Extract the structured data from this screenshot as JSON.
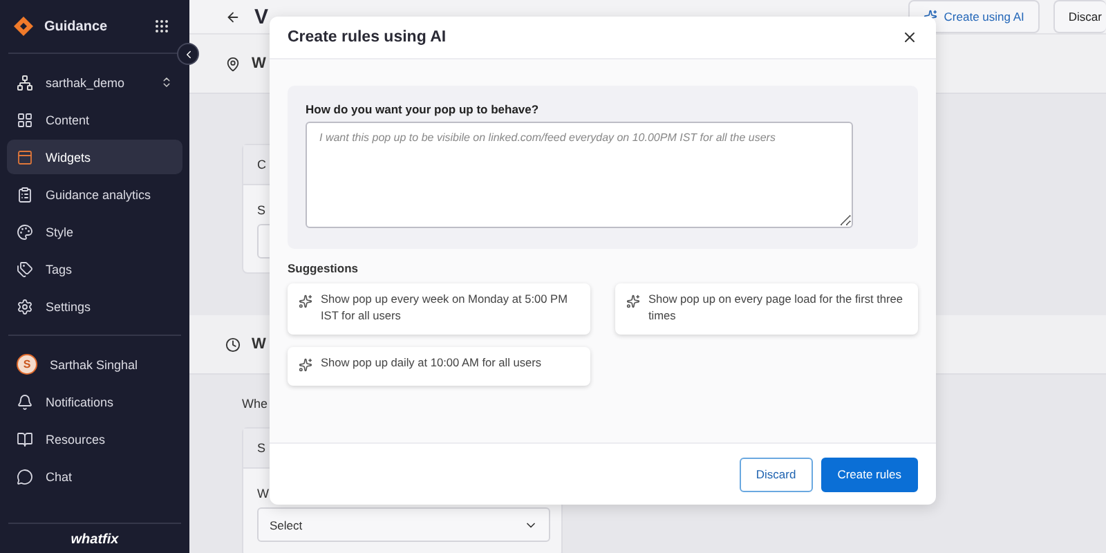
{
  "sidebar": {
    "brand": "Guidance",
    "workspace": "sarthak_demo",
    "nav": [
      {
        "label": "Content",
        "selected": false
      },
      {
        "label": "Widgets",
        "selected": true
      },
      {
        "label": "Guidance analytics",
        "selected": false
      },
      {
        "label": "Style",
        "selected": false
      },
      {
        "label": "Tags",
        "selected": false
      },
      {
        "label": "Settings",
        "selected": false
      }
    ],
    "user": {
      "initial": "S",
      "name": "Sarthak Singhal"
    },
    "links": [
      "Notifications",
      "Resources",
      "Chat"
    ],
    "footer_logo": "whatfix"
  },
  "header": {
    "title": "V",
    "buttons": [
      {
        "label": "Create using AI",
        "kind": "ai"
      },
      {
        "label": "Discar",
        "kind": "plain"
      }
    ]
  },
  "sections": [
    {
      "heading": "W",
      "card": {
        "title": "C",
        "label": "S"
      }
    },
    {
      "heading": "W",
      "question": "Whe",
      "card": {
        "title": "S",
        "label": "W",
        "value": "Select"
      }
    }
  ],
  "modal": {
    "title": "Create rules using AI",
    "prompt_label": "How do you want your pop up to behave?",
    "placeholder": "I want this pop up to be visibile on linked.com/feed everyday on 10.00PM IST for all the users",
    "suggestions_label": "Suggestions",
    "suggestions": [
      "Show pop up every week on Monday at 5:00 PM IST for all users",
      "Show pop up on every page load for the first three times",
      "Show pop up daily at 10:00 AM for all users"
    ],
    "buttons": [
      {
        "label": "Discard",
        "kind": "secondary"
      },
      {
        "label": "Create rules",
        "kind": "primary"
      }
    ]
  }
}
